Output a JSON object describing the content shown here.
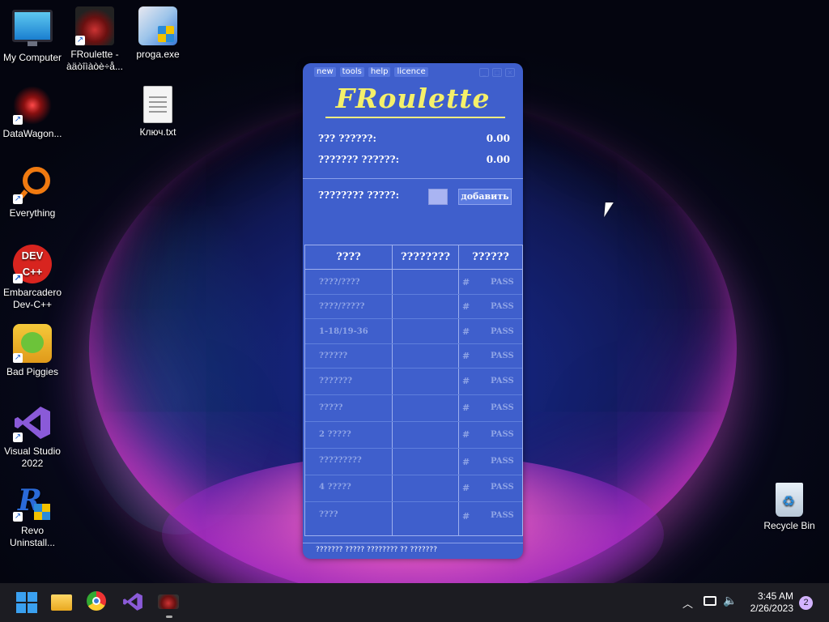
{
  "desktop": {
    "icons": [
      {
        "label": "My Computer"
      },
      {
        "label": "FRoulette - àäòîìàòè÷å..."
      },
      {
        "label": "proga.exe"
      },
      {
        "label": "DataWagon..."
      },
      {
        "label": "Ключ.txt"
      },
      {
        "label": "Everything"
      },
      {
        "label": "Embarcadero Dev-C++"
      },
      {
        "label": "Bad Piggies"
      },
      {
        "label": "Visual Studio 2022"
      },
      {
        "label": "Revo Uninstall..."
      },
      {
        "label": "Recycle Bin"
      }
    ]
  },
  "app": {
    "menu": [
      "new",
      "tools",
      "help",
      "licence"
    ],
    "title": "FRoulette",
    "stats": [
      {
        "label": "??? ??????:",
        "value": "0.00"
      },
      {
        "label": "??????? ??????:",
        "value": "0.00"
      }
    ],
    "add_label": "???????? ?????:",
    "add_button": "добавить",
    "table": {
      "headers": [
        "????",
        "????????",
        "??????"
      ],
      "rows": [
        {
          "name": "????/????",
          "hash": "#",
          "pass": "PASS"
        },
        {
          "name": "????/?????",
          "hash": "#",
          "pass": "PASS"
        },
        {
          "name": "1-18/19-36",
          "hash": "#",
          "pass": "PASS"
        },
        {
          "name": "??????",
          "hash": "#",
          "pass": "PASS"
        },
        {
          "name": "???????",
          "hash": "#",
          "pass": "PASS"
        },
        {
          "name": "?????",
          "hash": "#",
          "pass": "PASS"
        },
        {
          "name": "2 ?????",
          "hash": "#",
          "pass": "PASS"
        },
        {
          "name": "?????????",
          "hash": "#",
          "pass": "PASS"
        },
        {
          "name": "4 ?????",
          "hash": "#",
          "pass": "PASS"
        },
        {
          "name": "????",
          "hash": "#",
          "pass": "PASS"
        }
      ]
    },
    "status": "??????? ????? ???????? ?? ???????"
  },
  "taskbar": {
    "time": "3:45 AM",
    "date": "2/26/2023",
    "notifications": "2"
  },
  "colors": {
    "window_bg": "#3f5fcc",
    "title_yellow": "#f5f06a",
    "taskbar_bg": "#1c1c22"
  }
}
